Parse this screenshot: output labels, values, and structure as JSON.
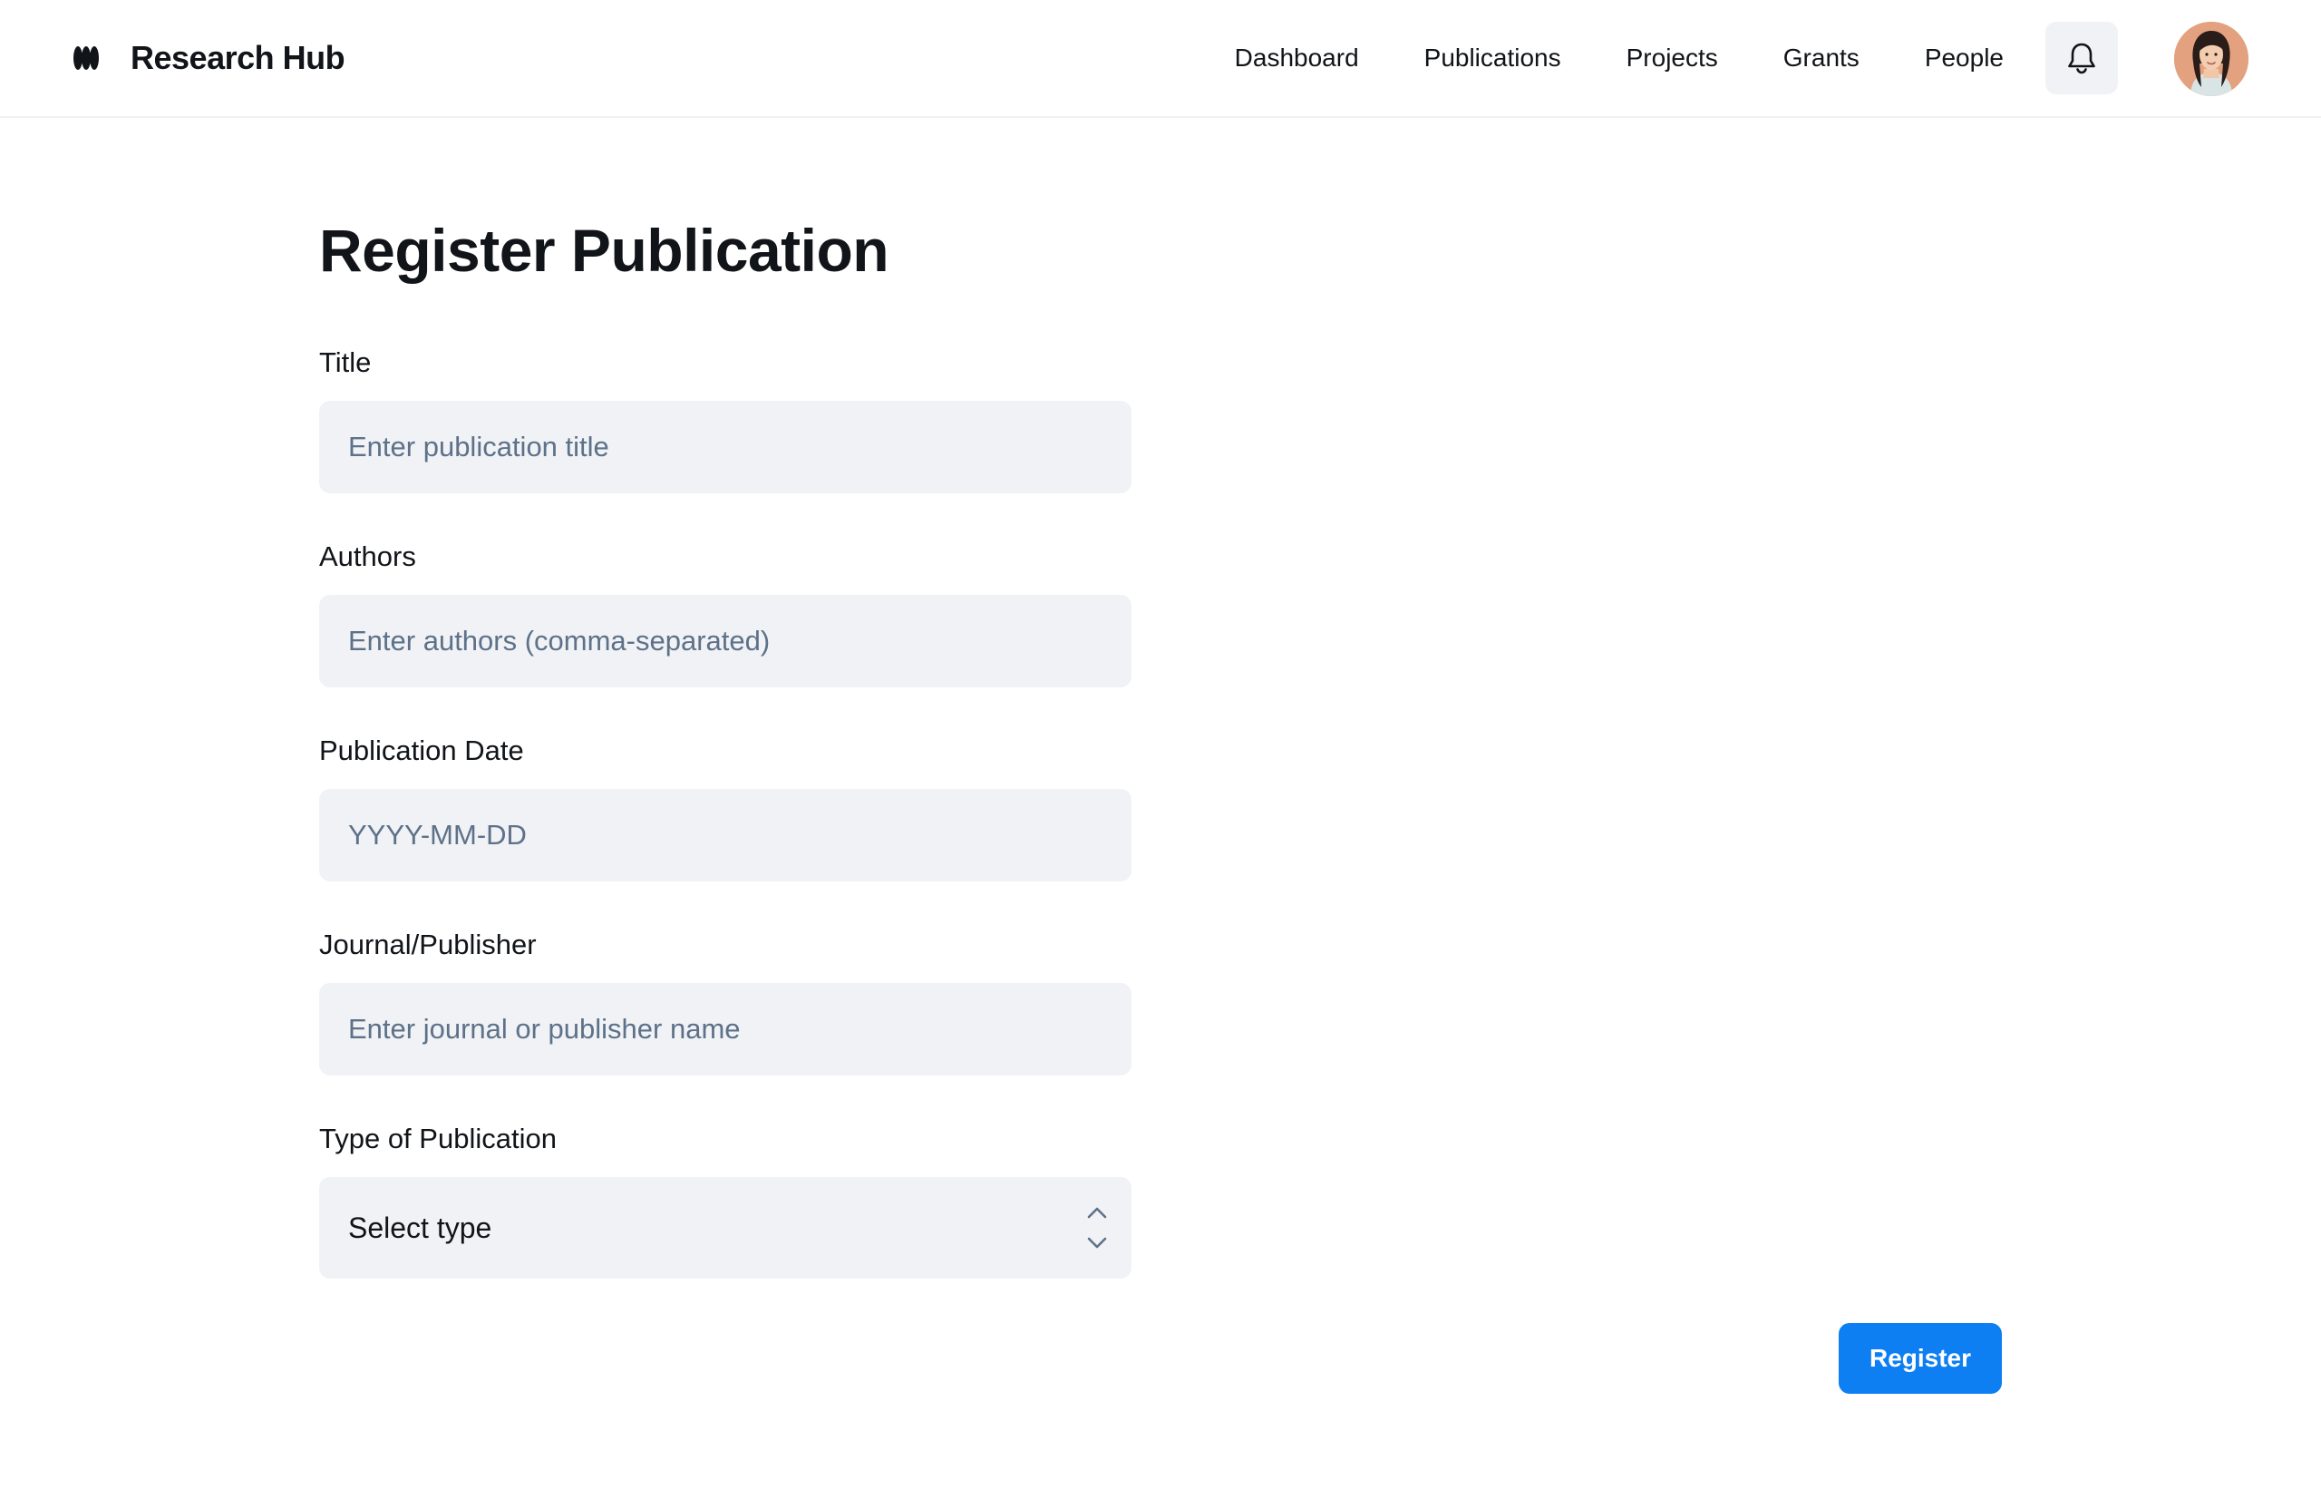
{
  "app": {
    "name": "Research Hub"
  },
  "nav": {
    "items": [
      {
        "label": "Dashboard"
      },
      {
        "label": "Publications"
      },
      {
        "label": "Projects"
      },
      {
        "label": "Grants"
      },
      {
        "label": "People"
      }
    ]
  },
  "icons": {
    "logo": "brand-logo-icon",
    "notifications": "bell-icon",
    "select": "chevron-up-down-icon"
  },
  "colors": {
    "accent": "#0d7ff2",
    "input_background": "#f0f2f5",
    "placeholder": "#5d7189",
    "text": "#111418"
  },
  "page": {
    "title": "Register Publication"
  },
  "form": {
    "title": {
      "label": "Title",
      "placeholder": "Enter publication title",
      "value": ""
    },
    "authors": {
      "label": "Authors",
      "placeholder": "Enter authors (comma-separated)",
      "value": ""
    },
    "date": {
      "label": "Publication Date",
      "placeholder": "YYYY-MM-DD",
      "value": ""
    },
    "journal": {
      "label": "Journal/Publisher",
      "placeholder": "Enter journal or publisher name",
      "value": ""
    },
    "type": {
      "label": "Type of Publication",
      "selected": "Select type"
    },
    "submit_label": "Register"
  }
}
